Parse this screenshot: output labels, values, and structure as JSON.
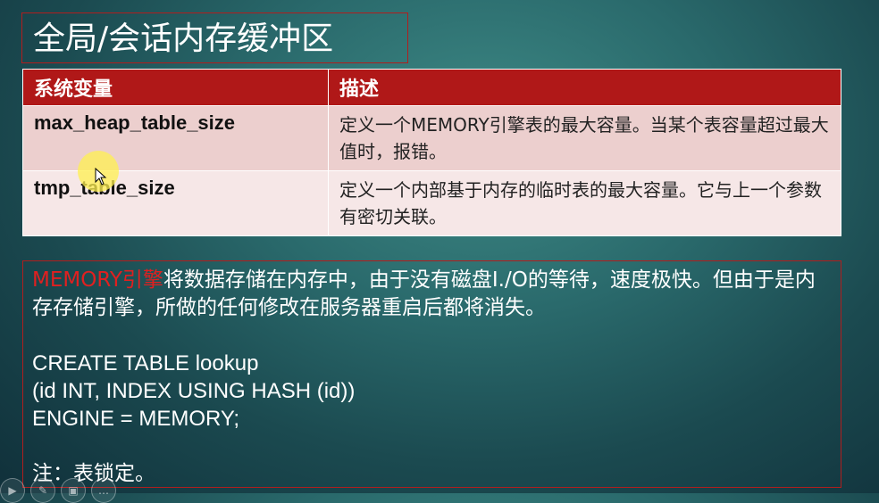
{
  "slide": {
    "title": "全局/会话内存缓冲区"
  },
  "table": {
    "headers": [
      "系统变量",
      "描述"
    ],
    "rows": [
      {
        "variable": "max_heap_table_size",
        "description": "定义一个MEMORY引擎表的最大容量。当某个表容量超过最大值时，报错。"
      },
      {
        "variable": "tmp_table_size",
        "description": "定义一个内部基于内存的临时表的最大容量。它与上一个参数有密切关联。"
      }
    ]
  },
  "note": {
    "highlight": "MEMORY引擎",
    "text": "将数据存储在内存中，由于没有磁盘I./O的等待，速度极快。但由于是内存存储引擎，所做的任何修改在服务器重启后都将消失。",
    "code_lines": [
      "CREATE TABLE lookup",
      "(id INT, INDEX USING HASH (id))",
      "ENGINE = MEMORY;"
    ],
    "footnote": "注：表锁定。"
  },
  "colors": {
    "accent_red": "#b01818",
    "highlight_red": "#e02020"
  },
  "controls": [
    "play-icon",
    "pen-icon",
    "slides-icon",
    "more-icon"
  ]
}
